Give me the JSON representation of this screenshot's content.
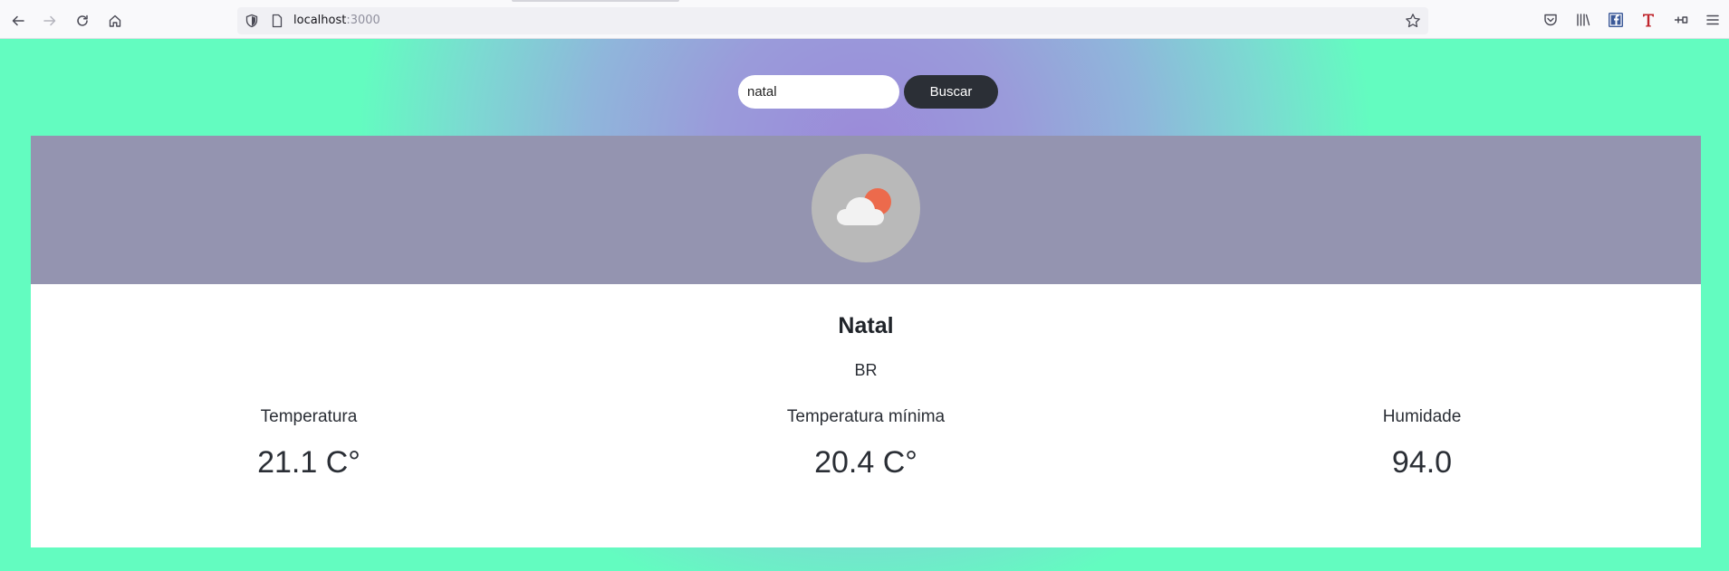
{
  "browser": {
    "url_host": "localhost",
    "url_port": ":3000",
    "icons": [
      "back-icon",
      "forward-icon",
      "reload-icon",
      "home-icon",
      "shield-icon",
      "page-icon",
      "bookmark-star-icon",
      "pocket-icon",
      "library-icon",
      "facebook-container-icon",
      "t-extension-icon",
      "pin-extension-icon",
      "menu-icon"
    ]
  },
  "search": {
    "value": "natal",
    "button_label": "Buscar"
  },
  "weather": {
    "city": "Natal",
    "country": "BR",
    "stats": [
      {
        "label": "Temperatura",
        "value": "21.1 C°"
      },
      {
        "label": "Temperatura mínima",
        "value": "20.4 C°"
      },
      {
        "label": "Humidade",
        "value": "94.0"
      }
    ],
    "icon": "cloud-sun-icon"
  },
  "colors": {
    "header_band": "#9494b0",
    "button_bg": "#2b2f36",
    "sun": "#ec6a4c",
    "cloud": "#f2f2f2",
    "gradient_center": "#9b8ad9",
    "gradient_edge": "#63fcc0"
  }
}
